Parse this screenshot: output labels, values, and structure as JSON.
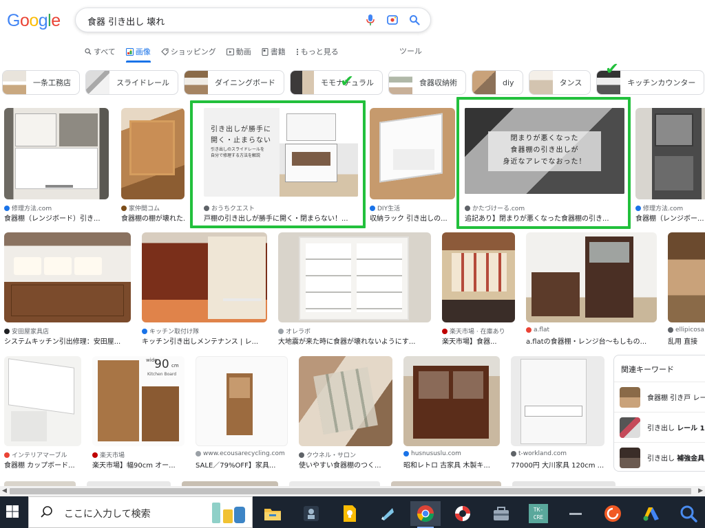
{
  "logo": {
    "letters": [
      "G",
      "o",
      "o",
      "g",
      "l",
      "e"
    ],
    "colors": [
      "#4285f4",
      "#ea4335",
      "#fbbc05",
      "#4285f4",
      "#34a853",
      "#ea4335"
    ]
  },
  "search": {
    "query": "食器 引き出し 壊れ"
  },
  "tabs": [
    {
      "label": "すべて",
      "icon": "search-icon"
    },
    {
      "label": "画像",
      "icon": "image-icon",
      "active": true
    },
    {
      "label": "ショッピング",
      "icon": "tag-icon"
    },
    {
      "label": "動画",
      "icon": "play-icon"
    },
    {
      "label": "書籍",
      "icon": "book-icon"
    },
    {
      "label": "もっと見る",
      "icon": "more-vert-icon"
    }
  ],
  "tools_label": "ツール",
  "chips": [
    {
      "label": "一条工務店"
    },
    {
      "label": "スライドレール"
    },
    {
      "label": "ダイニングボード"
    },
    {
      "label": "モモナチュラル"
    },
    {
      "label": "食器収納術"
    },
    {
      "label": "diy"
    },
    {
      "label": "タンス"
    },
    {
      "label": "キッチンカウンター"
    }
  ],
  "results_row1": [
    {
      "source": "修理方法.com",
      "title": "食器棚（レンジボード）引き..."
    },
    {
      "source": "家仲間コム",
      "title": "食器棚の棚が壊れた..."
    },
    {
      "source": "おうちクエスト",
      "title": "戸棚の引き出しが勝手に開く・閉まらない！...",
      "thumb_text_line1": "引き出しが勝手に",
      "thumb_text_line2": "開く・止まらない",
      "thumb_text_small1": "引き出しのスライドレールを",
      "thumb_text_small2": "自分で修理する方法を解説"
    },
    {
      "source": "DIY生活",
      "title": "収納ラック 引き出しの..."
    },
    {
      "source": "かたづけーる.com",
      "title": "追記あり】閉まりが悪くなった食器棚の引き...",
      "thumb_text_line1": "閉まりが悪くなった",
      "thumb_text_line2": "食器棚の引き出しが",
      "thumb_text_line3": "身近なアレでなおった！"
    },
    {
      "source": "修理方法.com",
      "title": "食器棚（レンジボー..."
    }
  ],
  "results_row2": [
    {
      "source": "安田屋家具店",
      "title": "システムキッチン引出修理：安田屋..."
    },
    {
      "source": "キッチン取付け隊",
      "title": "キッチン引き出しメンテナンス | レ..."
    },
    {
      "source": "オレラボ",
      "title": "大地震が来た時に食器が壊れないようにす..."
    },
    {
      "source": "楽天市場 · 在庫あり",
      "title": "楽天市場】食器..."
    },
    {
      "source": "a.flat",
      "title": "a.flatの食器棚・レンジ台〜もしもの..."
    },
    {
      "source": "ellipicosa...",
      "title": "乱用 直接"
    }
  ],
  "results_row3": [
    {
      "source": "インテリアマーブル",
      "title": "食器棚 カップボード..."
    },
    {
      "source": "楽天市場",
      "title": "楽天市場】幅90cm オー...",
      "thumb_text_top": "wide",
      "thumb_text_big": "90",
      "thumb_text_unit": "cm",
      "thumb_text_sub": "Kitchen Board"
    },
    {
      "source": "www.ecousarecycling.com",
      "title": "SALE／79%OFF】家具..."
    },
    {
      "source": "クウネル・サロン",
      "title": "使いやすい食器棚のつく..."
    },
    {
      "source": "husnususlu.com",
      "title": "昭和レトロ 古家具 木製キ..."
    },
    {
      "source": "t-workland.com",
      "title": "77000円 大川家具 120cm ..."
    }
  ],
  "related": {
    "title": "関連キーワード",
    "items": [
      {
        "label": "食器棚 引き戸 レー"
      },
      {
        "label_prefix": "引き出し ",
        "label_bold": "レール 1(",
        "label": "引き出し レール 1("
      },
      {
        "label_prefix": "引き出し ",
        "label_bold": "補強金具",
        "label": "引き出し 補強金具"
      }
    ]
  },
  "taskbar": {
    "search_placeholder": "ここに入力して検索"
  },
  "colors": {
    "highlight": "#22c03c",
    "accent": "#1a73e8"
  }
}
